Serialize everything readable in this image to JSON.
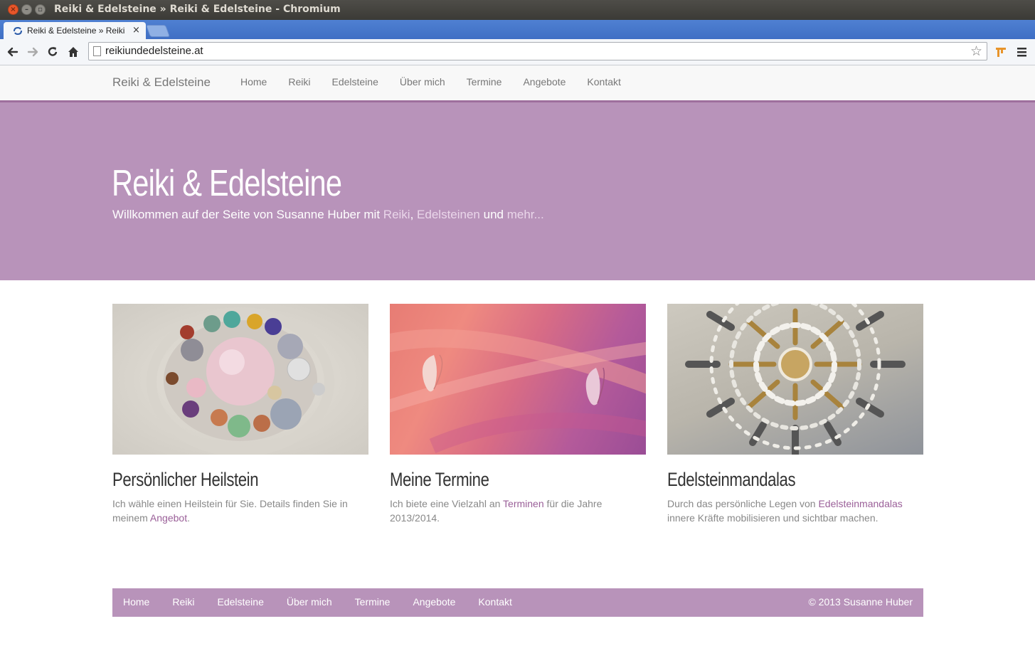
{
  "window": {
    "title": "Reiki & Edelsteine » Reiki & Edelsteine - Chromium"
  },
  "tab": {
    "title": "Reiki & Edelsteine » Reiki",
    "close": "×"
  },
  "omnibox": {
    "url": "reikiundedelsteine.at"
  },
  "site": {
    "brand": "Reiki & Edelsteine",
    "nav": [
      "Home",
      "Reiki",
      "Edelsteine",
      "Über mich",
      "Termine",
      "Angebote",
      "Kontakt"
    ],
    "hero": {
      "title": "Reiki & Edelsteine",
      "sub_prefix": "Willkommen auf der Seite von Susanne Huber mit ",
      "link_reiki": "Reiki",
      "comma": ", ",
      "link_edelsteine": "Edelsteinen",
      "and": " und ",
      "link_mehr": "mehr..."
    },
    "cards": [
      {
        "title": "Persönlicher Heilstein",
        "text_before": "Ich wähle einen Heilstein für Sie. Details finden Sie in meinem ",
        "link": "Angebot",
        "text_after": "."
      },
      {
        "title": "Meine Termine",
        "text_before": "Ich biete eine Vielzahl an ",
        "link": "Terminen",
        "text_after": " für die Jahre 2013/2014."
      },
      {
        "title": "Edelsteinmandalas",
        "text_before": "Durch das persönliche Legen von ",
        "link": "Edelsteinmandalas",
        "text_after": " innere Kräfte mobilisieren und sichtbar machen."
      }
    ],
    "footer": {
      "nav": [
        "Home",
        "Reiki",
        "Edelsteine",
        "Über mich",
        "Termine",
        "Angebote",
        "Kontakt"
      ],
      "copyright": "© 2013 Susanne Huber"
    }
  },
  "colors": {
    "accent": "#b893ba",
    "link": "#9a5f98",
    "nav_border": "#9e6f9d"
  }
}
